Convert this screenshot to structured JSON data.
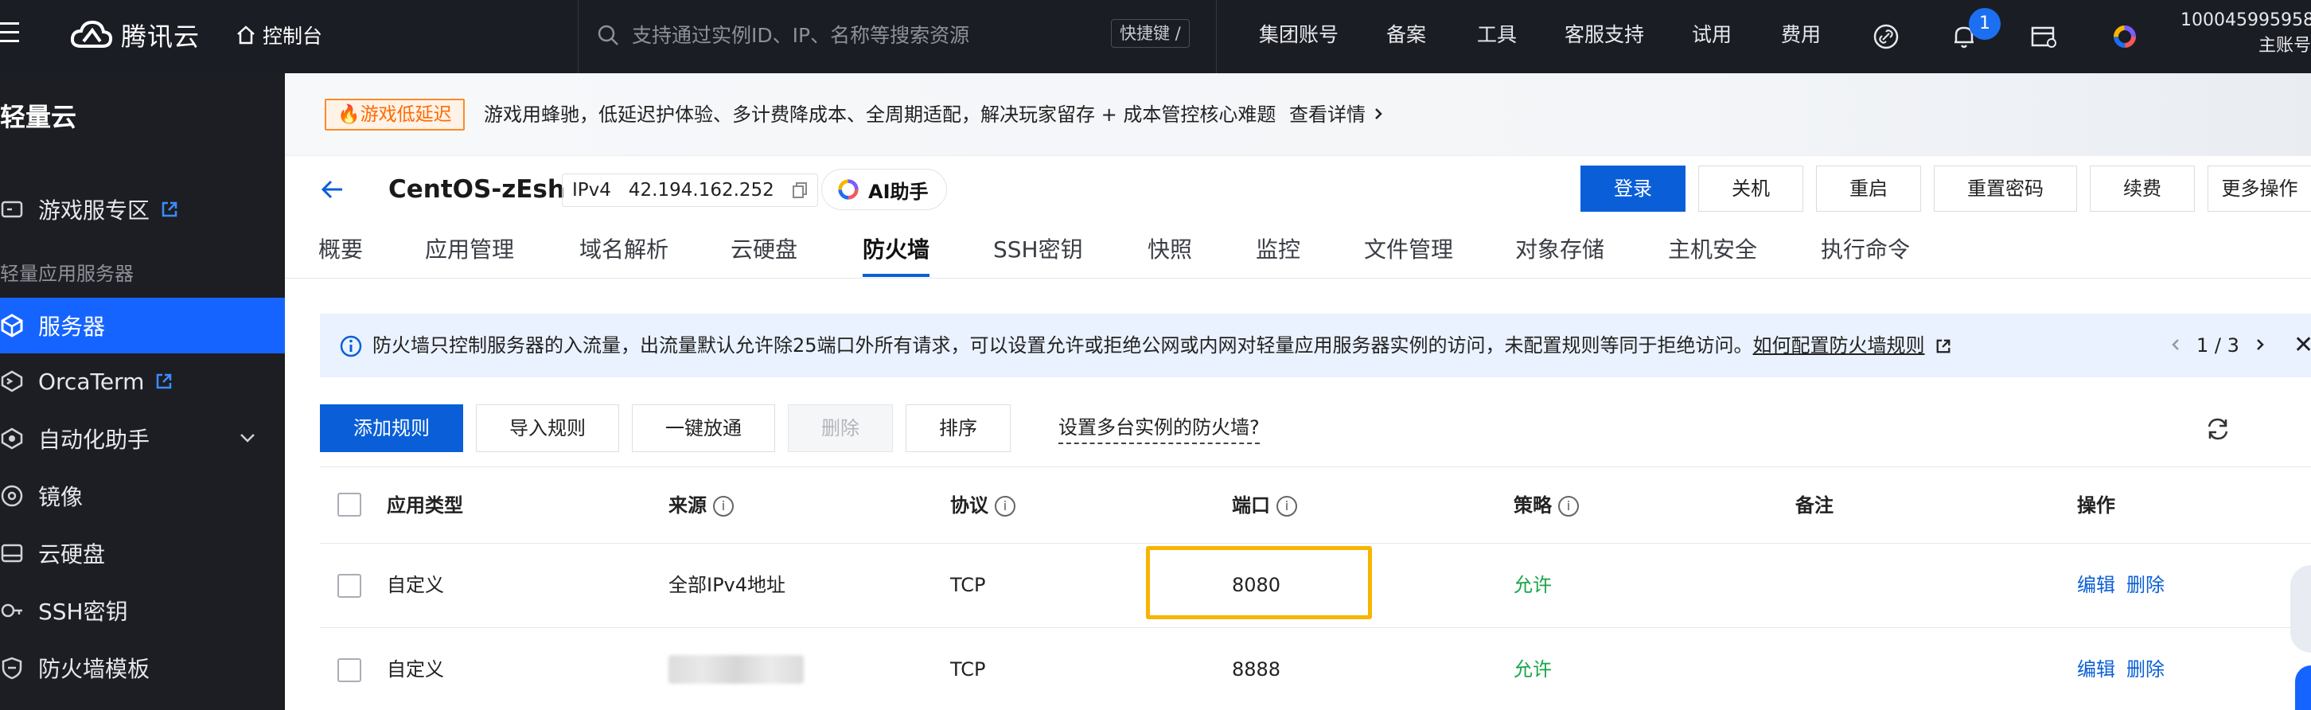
{
  "topbar": {
    "logo_text": "腾讯云",
    "console": "控制台",
    "search_placeholder": "支持通过实例ID、IP、名称等搜索资源",
    "shortcut": "快捷键 /",
    "nav": [
      "集团账号",
      "备案",
      "工具",
      "客服支持",
      "试用",
      "费用"
    ],
    "notification_count": "1",
    "user_id": "100045995958",
    "user_role": "主账号"
  },
  "sidebar": {
    "title": "轻量云",
    "items": [
      {
        "label": "游戏服专区",
        "icon": "game-server-icon",
        "external": true
      },
      {
        "label": "服务器",
        "icon": "server-icon",
        "active": true
      },
      {
        "label": "OrcaTerm",
        "icon": "terminal-icon",
        "external": true
      },
      {
        "label": "自动化助手",
        "icon": "automation-icon",
        "expandable": true
      },
      {
        "label": "镜像",
        "icon": "image-icon"
      },
      {
        "label": "云硬盘",
        "icon": "disk-icon"
      },
      {
        "label": "SSH密钥",
        "icon": "key-icon"
      },
      {
        "label": "防火墙模板",
        "icon": "firewall-icon"
      }
    ],
    "group_label": "轻量应用服务器"
  },
  "promo": {
    "tag": "游戏低延迟",
    "text": "游戏用蜂驰，低延迟护体验、多计费降成本、全周期适配，解决玩家留存 + 成本管控核心难题",
    "link": "查看详情"
  },
  "instance": {
    "name": "CentOS-zEsh",
    "ip_type": "IPv4",
    "ip": "42.194.162.252",
    "ai_label": "AI助手",
    "actions": [
      "登录",
      "关机",
      "重启",
      "重置密码",
      "续费",
      "更多操作"
    ]
  },
  "tabs": [
    "概要",
    "应用管理",
    "域名解析",
    "云硬盘",
    "防火墙",
    "SSH密钥",
    "快照",
    "监控",
    "文件管理",
    "对象存储",
    "主机安全",
    "执行命令"
  ],
  "active_tab": "防火墙",
  "notice": {
    "text": "防火墙只控制服务器的入流量，出流量默认允许除25端口外所有请求，可以设置允许或拒绝公网或内网对轻量应用服务器实例的访问，未配置规则等同于拒绝访问。",
    "link": "如何配置防火墙规则",
    "pager": "1 / 3"
  },
  "toolbar": {
    "buttons": [
      "添加规则",
      "导入规则",
      "一键放通",
      "删除",
      "排序"
    ],
    "multi_link": "设置多台实例的防火墙?"
  },
  "table": {
    "headers": [
      "应用类型",
      "来源",
      "协议",
      "端口",
      "策略",
      "备注",
      "操作"
    ],
    "rows": [
      {
        "type": "自定义",
        "source": "全部IPv4地址",
        "protocol": "TCP",
        "port": "8080",
        "policy": "允许",
        "note": "",
        "edit": "编辑",
        "delete": "删除"
      },
      {
        "type": "自定义",
        "source": "",
        "protocol": "TCP",
        "port": "8888",
        "policy": "允许",
        "note": "",
        "edit": "编辑",
        "delete": "删除"
      }
    ]
  },
  "colors": {
    "primary": "#0a5fd8",
    "sidebar_active": "#1664ff",
    "allow": "#19a648",
    "highlight": "#f7b500",
    "promo_tag": "#ff6a00"
  }
}
